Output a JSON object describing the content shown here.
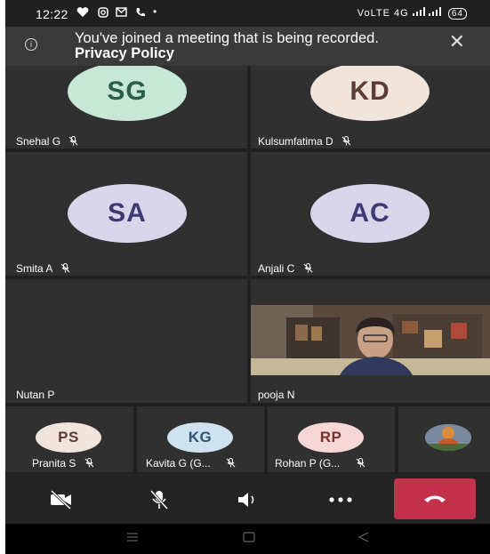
{
  "status_bar": {
    "time": "12:22",
    "left_icons": [
      "heart-shield-icon",
      "instagram-icon",
      "gmail-icon",
      "phone-icon",
      "dot-icon"
    ],
    "network": "VoLTE 4G",
    "battery": "64"
  },
  "banner": {
    "message": "You've joined a meeting that is being recorded.",
    "link": "Privacy Policy"
  },
  "colors": {
    "background": "#202020",
    "tile": "#303030",
    "avatar_green": "#c8e8d7",
    "avatar_green_text": "#2b5e48",
    "avatar_peach": "#f1e4da",
    "avatar_peach_text": "#5d3c33",
    "avatar_lavender": "#d9d6ec",
    "avatar_lavender_text": "#3f3a73",
    "avatar_blue": "#cfe2ef",
    "avatar_blue_text": "#2e5573",
    "avatar_pink": "#f6d7d5",
    "avatar_pink_text": "#7a2f2b",
    "hangup": "#c4314b"
  },
  "participants": {
    "p1": {
      "initials": "SG",
      "name": "Snehal G",
      "muted": true
    },
    "p2": {
      "initials": "KD",
      "name": "Kulsumfatima D",
      "muted": true
    },
    "p3": {
      "initials": "SA",
      "name": "Smita A",
      "muted": true
    },
    "p4": {
      "initials": "AC",
      "name": "Anjali C",
      "muted": true
    },
    "p5": {
      "name": "Nutan P"
    },
    "p6": {
      "name": "pooja N"
    }
  },
  "row_participants": {
    "r1": {
      "initials": "PS",
      "name": "Pranita S",
      "muted": true
    },
    "r2": {
      "initials": "KG",
      "name": "Kavita G (G...",
      "muted": true
    },
    "r3": {
      "initials": "RP",
      "name": "Rohan P (G...",
      "muted": true
    }
  },
  "controls": [
    "camera-off-icon",
    "mic-off-icon",
    "speaker-icon",
    "more-options-icon",
    "hang-up-icon"
  ]
}
